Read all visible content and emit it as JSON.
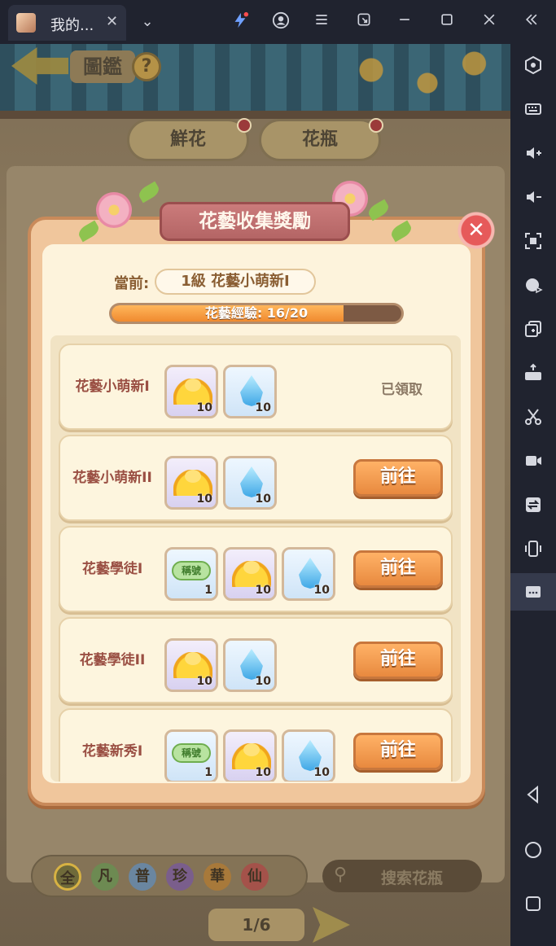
{
  "window": {
    "tab_title": "我的...",
    "tab_close": "✕",
    "dropdown": "⌄"
  },
  "topbar_icons": [
    "lightning-icon",
    "account-icon",
    "menu-icon",
    "restore-icon",
    "minimize-icon",
    "maximize-icon",
    "close-icon",
    "collapse-icon"
  ],
  "sidebar_icons": [
    "settings-hex-icon",
    "keyboard-icon",
    "volume-up-icon",
    "volume-down-icon",
    "screenshot-icon",
    "macro-icon",
    "multi-instance-icon",
    "apk-icon",
    "cut-icon",
    "record-icon",
    "sync-icon",
    "shake-icon",
    "more-icon",
    "back-icon",
    "home-icon",
    "recent-icon"
  ],
  "game": {
    "page_title": "圖鑑",
    "help_label": "?",
    "tabs": [
      {
        "label": "鮮花"
      },
      {
        "label": "花瓶"
      }
    ],
    "filters": [
      "全",
      "凡",
      "普",
      "珍",
      "華",
      "仙"
    ],
    "filter_colors": [
      "#6f6a3a",
      "#6d8a52",
      "#6a86a0",
      "#7a5e8c",
      "#a8793a",
      "#a4524a"
    ],
    "search_placeholder": "搜索花瓶",
    "pager": "1/6"
  },
  "modal": {
    "title": "花藝收集獎勵",
    "current_label": "當前:",
    "current_level": "1級  花藝小萌新I",
    "exp_text": "花藝經驗: 16/20",
    "exp_progress": 0.8,
    "rows": [
      {
        "name": "花藝小萌新I",
        "rewards": [
          {
            "kind": "ingot",
            "count": "10"
          },
          {
            "kind": "water",
            "count": "10"
          }
        ],
        "status": "已領取",
        "button": ""
      },
      {
        "name": "花藝小萌新II",
        "rewards": [
          {
            "kind": "ingot",
            "count": "10"
          },
          {
            "kind": "water",
            "count": "10"
          }
        ],
        "status": "",
        "button": "前往"
      },
      {
        "name": "花藝學徒I",
        "rewards": [
          {
            "kind": "title",
            "label": "稱號",
            "count": "1"
          },
          {
            "kind": "ingot",
            "count": "10"
          },
          {
            "kind": "water",
            "count": "10"
          }
        ],
        "status": "",
        "button": "前往"
      },
      {
        "name": "花藝學徒II",
        "rewards": [
          {
            "kind": "ingot",
            "count": "10"
          },
          {
            "kind": "water",
            "count": "10"
          }
        ],
        "status": "",
        "button": "前往"
      },
      {
        "name": "花藝新秀I",
        "rewards": [
          {
            "kind": "title",
            "label": "稱號",
            "count": "1"
          },
          {
            "kind": "ingot",
            "count": "10"
          },
          {
            "kind": "water",
            "count": "10"
          }
        ],
        "status": "",
        "button": "前往"
      }
    ]
  }
}
